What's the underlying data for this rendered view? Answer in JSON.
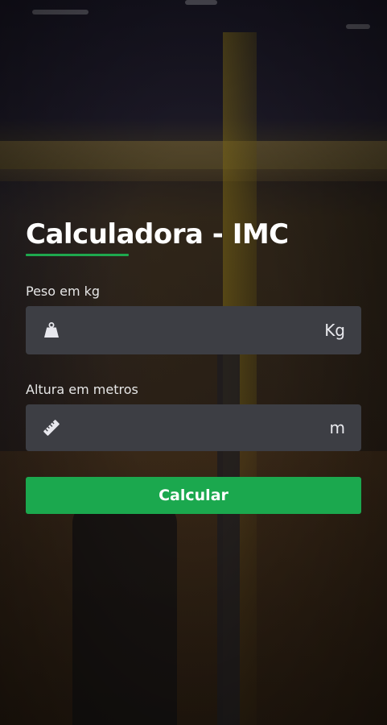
{
  "app": {
    "title": "Calculadora - IMC"
  },
  "form": {
    "weight": {
      "label": "Peso em kg",
      "value": "",
      "placeholder": "",
      "unit": "Kg",
      "icon": "weight-icon"
    },
    "height": {
      "label": "Altura em metros",
      "value": "",
      "placeholder": "",
      "unit": "m",
      "icon": "ruler-icon"
    },
    "submit_label": "Calcular"
  },
  "colors": {
    "accent": "#1ba84e",
    "field_bg": "#3d3e44",
    "text": "#ffffff"
  }
}
